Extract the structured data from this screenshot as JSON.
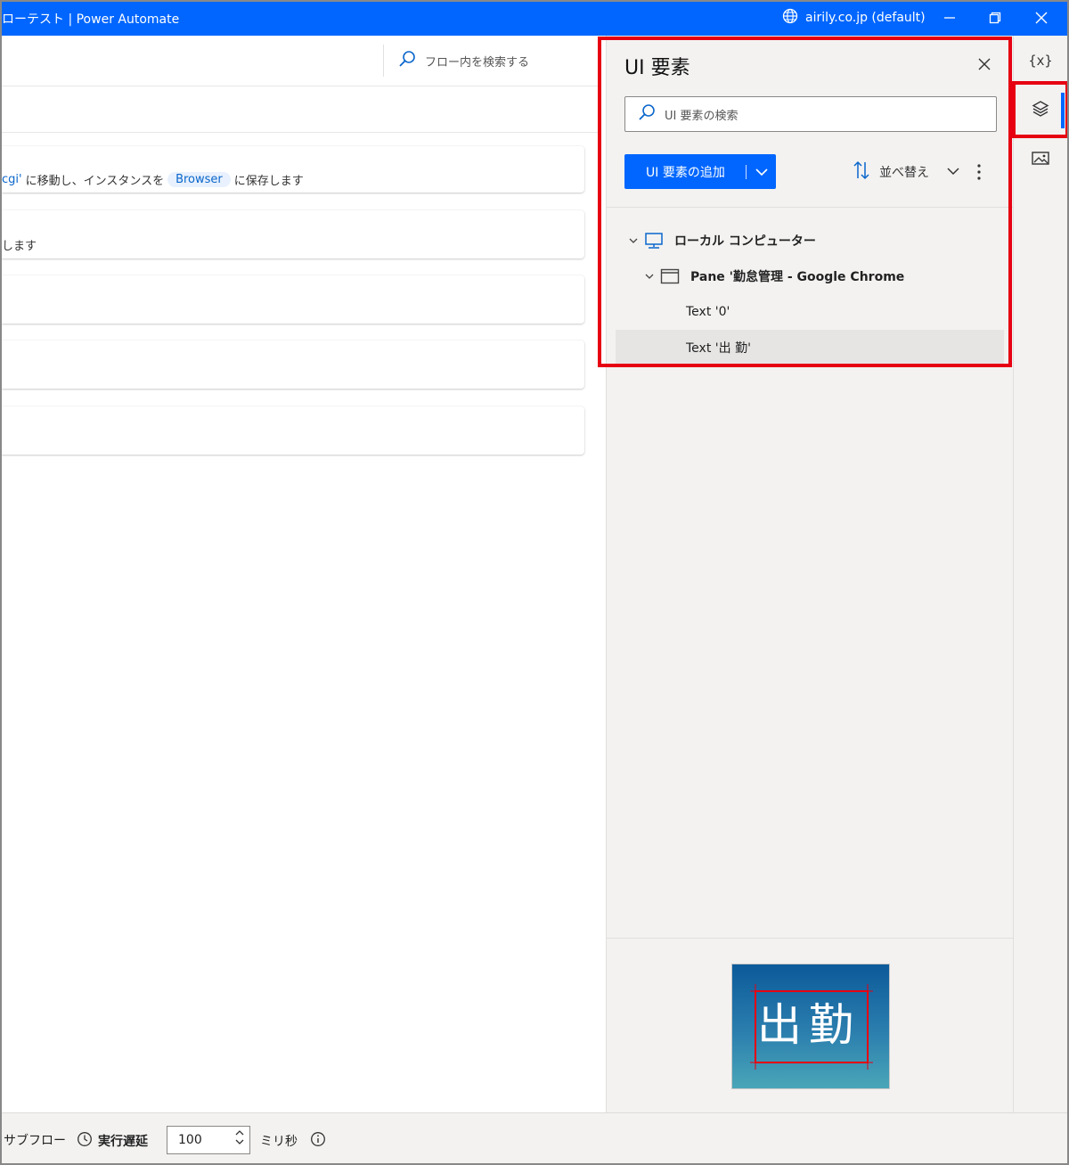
{
  "window": {
    "title": "ローテスト | Power Automate",
    "environment": "airily.co.jp (default)"
  },
  "flow": {
    "search_placeholder": "フロー内を検索する",
    "actions": [
      {
        "prefix": "cgi'",
        "text_a": "に移動し、インスタンスを",
        "variable": "Browser",
        "text_b": "に保存します"
      },
      {
        "text": "します"
      },
      {
        "text": ""
      },
      {
        "text": ""
      },
      {
        "text": ""
      }
    ]
  },
  "ui_panel": {
    "title": "UI 要素",
    "search_placeholder": "UI 要素の検索",
    "add_button_label": "UI 要素の追加",
    "sort_label": "並べ替え",
    "tree": [
      {
        "label": "ローカル コンピューター",
        "level": 0,
        "icon": "monitor-icon",
        "expanded": true,
        "bold": true
      },
      {
        "label": "Pane '勤怠管理 - Google Chrome",
        "level": 1,
        "icon": "window-icon",
        "expanded": true,
        "bold": true
      },
      {
        "label": "Text '0'",
        "level": 2,
        "selected": false
      },
      {
        "label": "Text '出 勤'",
        "level": 2,
        "selected": true
      }
    ],
    "preview_text": "出勤"
  },
  "rail": {
    "variables_label": "{x}",
    "active": "ui-elements"
  },
  "statusbar": {
    "subflow_label": "サブフロー",
    "delay_label": "実行遅延",
    "delay_value": "100",
    "unit_label": "ミリ秒"
  },
  "colors": {
    "accent": "#0066ff",
    "highlight": "#e60012",
    "panel_bg": "#f3f2f1"
  }
}
